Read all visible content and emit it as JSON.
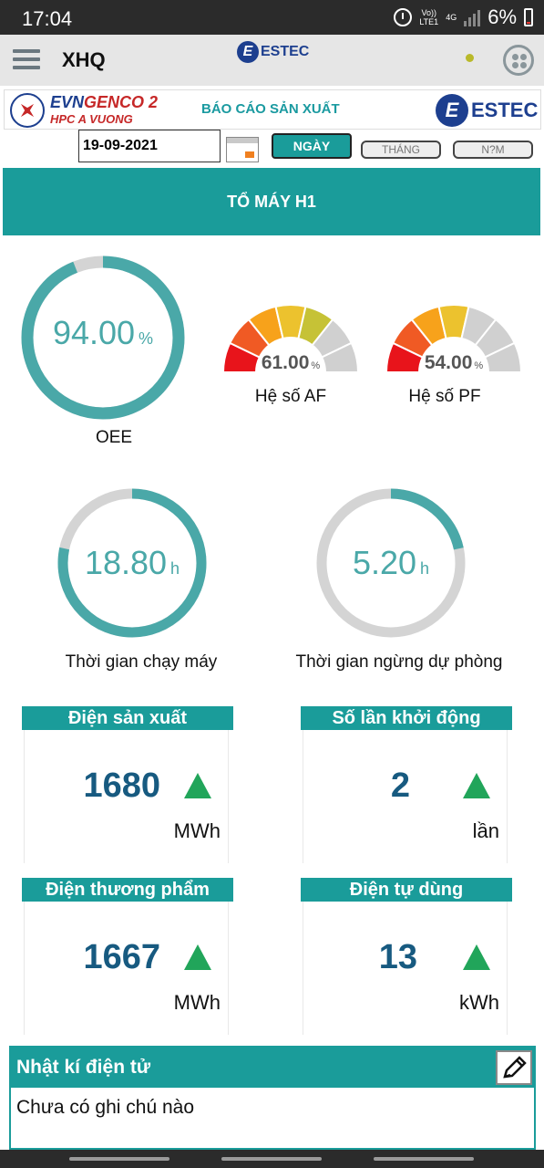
{
  "status": {
    "time": "17:04",
    "volte": "Vo))\nLTE1",
    "net": "4G",
    "battery": "6%"
  },
  "appbar": {
    "title": "XHQ",
    "logo_letter": "E",
    "logo_text": "ESTEC"
  },
  "report": {
    "company_name_blue": "EVN",
    "company_name_red": "GENCO 2",
    "company_sub": "HPC A VUONG",
    "title": "BÁO CÁO SẢN XUẤT",
    "logo_letter": "E",
    "logo_text": "ESTEC"
  },
  "filters": {
    "date": "19-09-2021",
    "btn_day": "NGÀY",
    "btn_month": "THÁNG",
    "btn_year": "N?M"
  },
  "unit_title": "TỔ MÁY H1",
  "gauges": {
    "oee": {
      "value": "94.00",
      "unit": "%",
      "label": "OEE",
      "fraction": 0.94
    },
    "af": {
      "value": "61.00",
      "unit": "%",
      "label": "Hệ số AF",
      "fraction": 0.61
    },
    "pf": {
      "value": "54.00",
      "unit": "%",
      "label": "Hệ số PF",
      "fraction": 0.54
    },
    "run": {
      "value": "18.80",
      "unit": "h",
      "label": "Thời gian chạy máy",
      "fraction": 0.7833
    },
    "standby": {
      "value": "5.20",
      "unit": "h",
      "label": "Thời gian ngừng dự phòng",
      "fraction": 0.2167
    }
  },
  "cards": [
    {
      "title": "Điện sản xuất",
      "value": "1680",
      "unit": "MWh"
    },
    {
      "title": "Số lần khởi động",
      "value": "2",
      "unit": "lần"
    },
    {
      "title": "Điện thương phẩm",
      "value": "1667",
      "unit": "MWh"
    },
    {
      "title": "Điện tự dùng",
      "value": "13",
      "unit": "kWh"
    }
  ],
  "journal": {
    "title": "Nhật kí điện tử",
    "note": "Chưa có ghi chú nào"
  },
  "colors": {
    "teal": "#1a9c9a",
    "ring": "#4aa8a8",
    "track": "#d4d4d4",
    "value_blue": "#175a80",
    "arrow_green": "#21a55a"
  }
}
